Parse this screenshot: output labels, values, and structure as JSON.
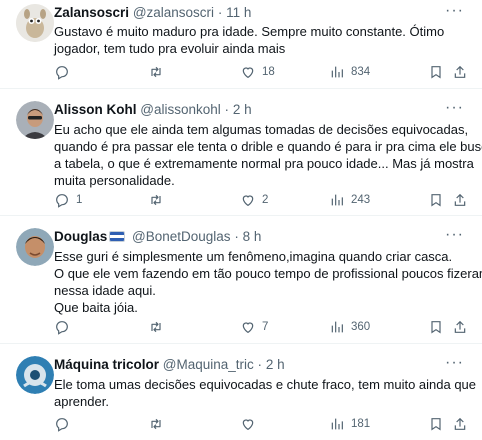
{
  "tweets": [
    {
      "name": "Zalansoscri",
      "handle": "@zalansoscri",
      "dot": "·",
      "time": "11 h",
      "more": "···",
      "lines": [
        "Gustavo é muito maduro pra idade. Sempre muito constante. Ótimo",
        "jogador, tem tudo pra evoluir ainda mais"
      ],
      "reply_count": "",
      "retweet_count": "",
      "like_count": "18",
      "view_count": "834",
      "has_flag": false
    },
    {
      "name": "Alisson Kohl",
      "handle": "@alissonkohl",
      "dot": "·",
      "time": "2 h",
      "more": "···",
      "lines": [
        "Eu acho que ele ainda tem algumas tomadas de decisões equivocadas,",
        "quando é pra passar ele tenta o drible e quando é para ir pra cima ele busca",
        "a tabela, o que é extremamente normal pra pouco idade... Mas já mostra",
        "muita personalidade."
      ],
      "reply_count": "1",
      "retweet_count": "",
      "like_count": "2",
      "view_count": "243",
      "has_flag": false
    },
    {
      "name": "Douglas",
      "handle": "@BonetDouglas",
      "dot": "·",
      "time": "8 h",
      "more": "···",
      "lines": [
        "Esse guri é simplesmente um fenômeno,imagina quando criar casca.",
        "O que ele vem fazendo em tão pouco tempo de profissional poucos fizeram",
        "nessa idade aqui.",
        "Que baita jóia."
      ],
      "reply_count": "",
      "retweet_count": "",
      "like_count": "7",
      "view_count": "360",
      "has_flag": true
    },
    {
      "name": "Máquina tricolor",
      "handle": "@Maquina_tric",
      "dot": "·",
      "time": "2 h",
      "more": "···",
      "lines": [
        "Ele toma umas decisões equivocadas e chute fraco, tem muito ainda que",
        "aprender."
      ],
      "reply_count": "",
      "retweet_count": "",
      "like_count": "",
      "view_count": "181",
      "has_flag": false
    }
  ],
  "icons": {
    "reply": "reply-icon",
    "retweet": "retweet-icon",
    "like": "like-icon",
    "views": "views-icon",
    "bookmark": "bookmark-icon",
    "share": "share-icon"
  }
}
